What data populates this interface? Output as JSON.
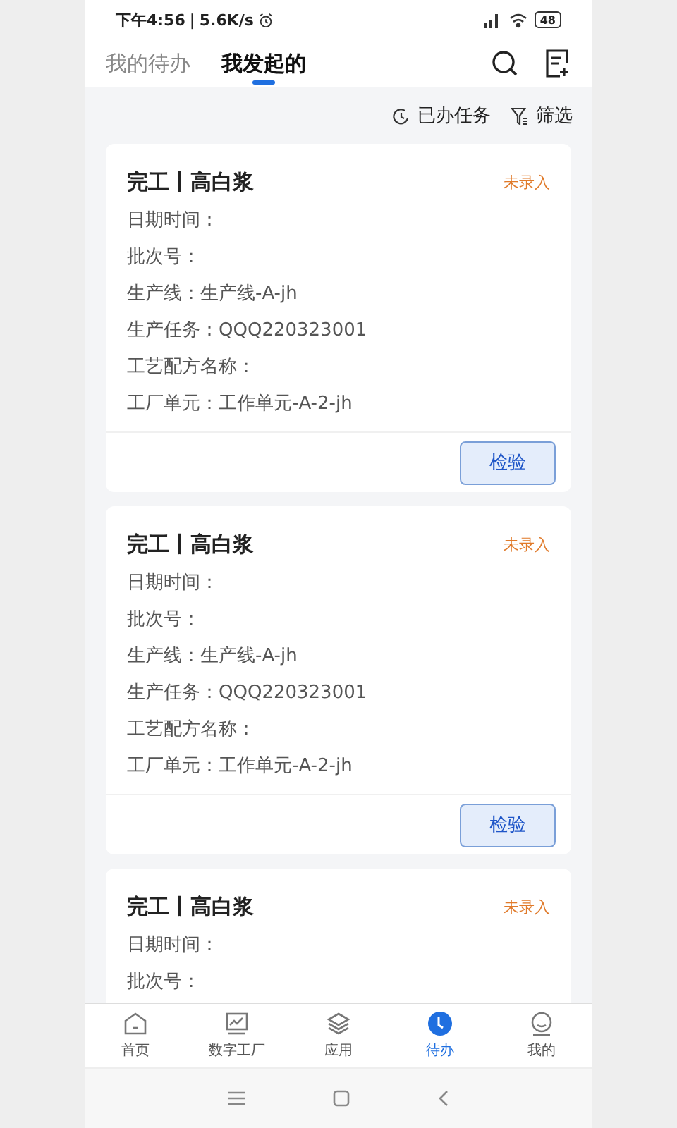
{
  "status_bar": {
    "time": "下午4:56",
    "separator": "|",
    "speed": "5.6K/s",
    "battery": "48"
  },
  "tabs": [
    {
      "label": "我的待办",
      "selected": false
    },
    {
      "label": "我发起的",
      "selected": true
    }
  ],
  "toolbar": {
    "done_tasks": "已办任务",
    "filter": "筛选"
  },
  "cards": [
    {
      "title": "完工丨高白浆",
      "status": "未录入",
      "fields": [
        "日期时间：",
        "批次号：",
        "生产线：生产线-A-jh",
        "生产任务：QQQ220323001",
        "工艺配方名称：",
        "工厂单元：工作单元-A-2-jh"
      ],
      "action": "检验"
    },
    {
      "title": "完工丨高白浆",
      "status": "未录入",
      "fields": [
        "日期时间：",
        "批次号：",
        "生产线：生产线-A-jh",
        "生产任务：QQQ220323001",
        "工艺配方名称：",
        "工厂单元：工作单元-A-2-jh"
      ],
      "action": "检验"
    },
    {
      "title": "完工丨高白浆",
      "status": "未录入",
      "fields": [
        "日期时间：",
        "批次号："
      ]
    }
  ],
  "bottom_nav": [
    {
      "kind": "home",
      "label": "首页",
      "selected": false
    },
    {
      "kind": "chart",
      "label": "数字工厂",
      "selected": false
    },
    {
      "kind": "layers",
      "label": "应用",
      "selected": false
    },
    {
      "kind": "clock",
      "label": "待办",
      "selected": true
    },
    {
      "kind": "user",
      "label": "我的",
      "selected": false
    }
  ]
}
